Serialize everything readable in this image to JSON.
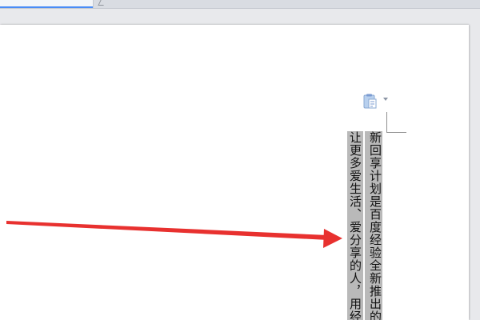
{
  "document": {
    "column_right_text": "新回享计划是百度经验全新推出的",
    "column_left_text": "让更多爱生活、爱分享的人，用经"
  },
  "icons": {
    "paste_options": "paste-options-icon",
    "dropdown": "chevron-down-icon"
  },
  "annotation": {
    "arrow_color": "#e8312f"
  },
  "colors": {
    "selection_highlight": "#b9b9b9",
    "tab_accent": "#4b8df6",
    "page_background": "#ffffff"
  }
}
